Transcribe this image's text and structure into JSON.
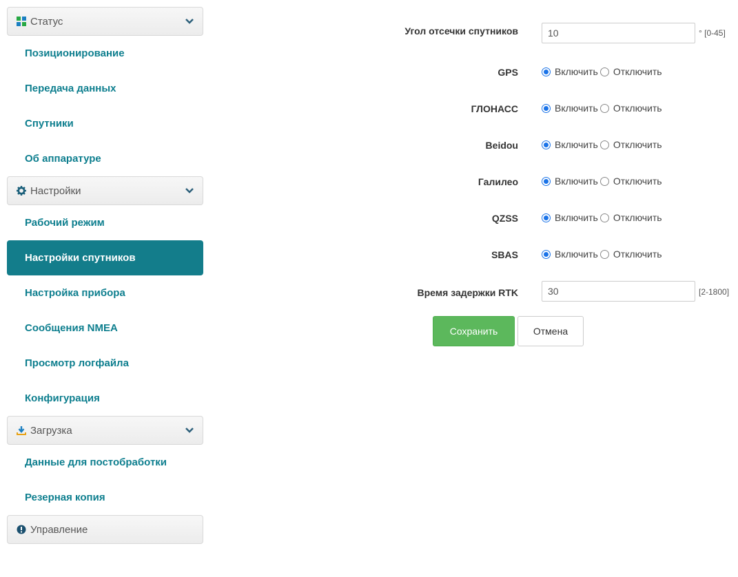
{
  "sidebar": {
    "sections": [
      {
        "title": "Статус",
        "icon": "grid-icon",
        "items": [
          "Позиционирование",
          "Передача данных",
          "Спутники",
          "Об аппаратуре"
        ]
      },
      {
        "title": "Настройки",
        "icon": "gear-icon",
        "items": [
          "Рабочий режим",
          "Настройки спутников",
          "Настройка прибора",
          "Сообщения NMEA",
          "Просмотр логфайла",
          "Конфигурация"
        ]
      },
      {
        "title": "Загрузка",
        "icon": "download-icon",
        "items": [
          "Данные для постобработки",
          "Резерная копия"
        ]
      },
      {
        "title": "Управление",
        "icon": "info-circle-icon",
        "items": []
      }
    ],
    "active_item": "Настройки спутников"
  },
  "form": {
    "cutoff_angle": {
      "label": "Угол отсечки спутников",
      "value": "10",
      "hint": "° [0-45]"
    },
    "systems": [
      {
        "label": "GPS",
        "selected": "enable"
      },
      {
        "label": "ГЛОНАСС",
        "selected": "enable"
      },
      {
        "label": "Beidou",
        "selected": "enable"
      },
      {
        "label": "Галилео",
        "selected": "enable"
      },
      {
        "label": "QZSS",
        "selected": "enable"
      },
      {
        "label": "SBAS",
        "selected": "enable"
      }
    ],
    "enable_label": "Включить",
    "disable_label": "Отключить",
    "rtk_delay": {
      "label": "Время задержки RTK",
      "value": "30",
      "hint": "[2-1800]"
    },
    "save_label": "Сохранить",
    "cancel_label": "Отмена"
  },
  "colors": {
    "accent": "#137d8b",
    "nav_text": "#0d7e8e",
    "save_button": "#5cb85c",
    "radio_checked": "#1a73e8"
  }
}
